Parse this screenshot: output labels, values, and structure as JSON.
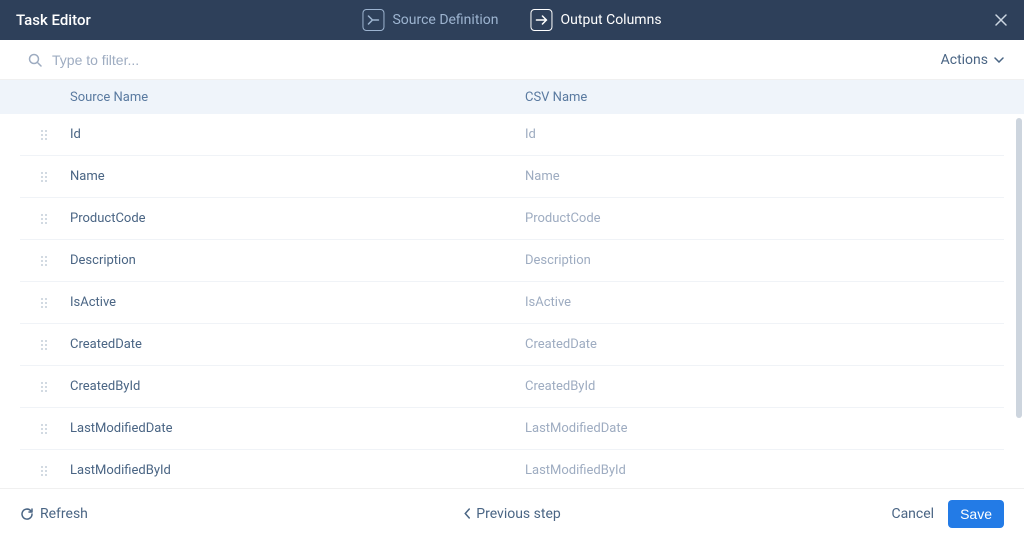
{
  "header": {
    "title": "Task Editor",
    "tabs": [
      {
        "label": "Source Definition",
        "active": false
      },
      {
        "label": "Output Columns",
        "active": true
      }
    ]
  },
  "toolbar": {
    "filter_placeholder": "Type to filter...",
    "actions_label": "Actions"
  },
  "table": {
    "col_source_label": "Source Name",
    "col_csv_label": "CSV Name",
    "rows": [
      {
        "source": "Id",
        "csv": "Id"
      },
      {
        "source": "Name",
        "csv": "Name"
      },
      {
        "source": "ProductCode",
        "csv": "ProductCode"
      },
      {
        "source": "Description",
        "csv": "Description"
      },
      {
        "source": "IsActive",
        "csv": "IsActive"
      },
      {
        "source": "CreatedDate",
        "csv": "CreatedDate"
      },
      {
        "source": "CreatedById",
        "csv": "CreatedById"
      },
      {
        "source": "LastModifiedDate",
        "csv": "LastModifiedDate"
      },
      {
        "source": "LastModifiedById",
        "csv": "LastModifiedById"
      }
    ]
  },
  "footer": {
    "refresh_label": "Refresh",
    "prev_label": "Previous step",
    "cancel_label": "Cancel",
    "save_label": "Save"
  }
}
